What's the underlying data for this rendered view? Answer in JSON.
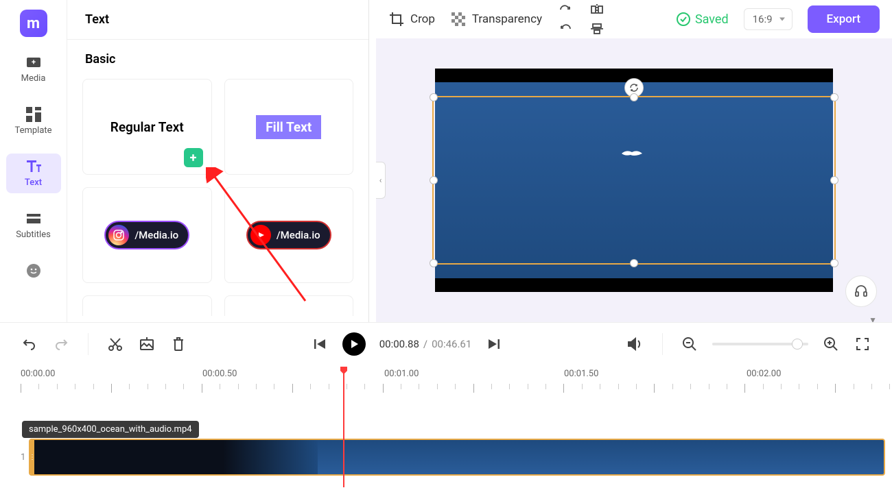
{
  "sidebar": {
    "items": [
      {
        "label": "Media"
      },
      {
        "label": "Template"
      },
      {
        "label": "Text"
      },
      {
        "label": "Subtitles"
      }
    ]
  },
  "panel": {
    "title": "Text",
    "section": "Basic",
    "cards": {
      "regular": "Regular Text",
      "fill": "Fill Text",
      "social1": "/Media.io",
      "social2": "/Media.io"
    }
  },
  "toolbar": {
    "crop": "Crop",
    "transparency": "Transparency",
    "saved": "Saved",
    "ratio": "16:9",
    "export": "Export"
  },
  "controls": {
    "time_current": "00:00.88",
    "time_sep": "/",
    "time_total": "00:46.61"
  },
  "timeline": {
    "labels": [
      "00:00.00",
      "00:00.50",
      "00:01.00",
      "00:01.50",
      "00:02.00"
    ],
    "clip_name": "sample_960x400_ocean_with_audio.mp4",
    "track_index": "1"
  }
}
